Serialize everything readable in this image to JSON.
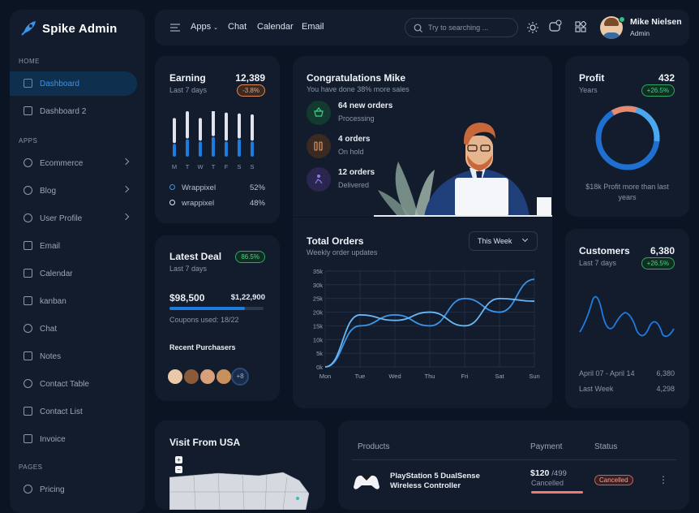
{
  "brand": {
    "name": "Spike Admin"
  },
  "sidebar": {
    "sections": [
      "HOME",
      "APPS",
      "PAGES"
    ],
    "items": [
      {
        "label": "Dashboard",
        "icon": "screen-icon"
      },
      {
        "label": "Dashboard 2",
        "icon": "chart-icon"
      },
      {
        "label": "Ecommerce",
        "icon": "cart-icon"
      },
      {
        "label": "Blog",
        "icon": "blog-icon"
      },
      {
        "label": "User Profile",
        "icon": "user-icon"
      },
      {
        "label": "Email",
        "icon": "mail-icon"
      },
      {
        "label": "Calendar",
        "icon": "calendar-icon"
      },
      {
        "label": "kanban",
        "icon": "kanban-icon"
      },
      {
        "label": "Chat",
        "icon": "chat-icon"
      },
      {
        "label": "Notes",
        "icon": "notes-icon"
      },
      {
        "label": "Contact Table",
        "icon": "phone-icon"
      },
      {
        "label": "Contact List",
        "icon": "list-icon"
      },
      {
        "label": "Invoice",
        "icon": "invoice-icon"
      },
      {
        "label": "Pricing",
        "icon": "currency-icon"
      }
    ]
  },
  "topbar": {
    "nav": [
      "Apps",
      "Chat",
      "Calendar",
      "Email"
    ],
    "search_placeholder": "Try to searching ...",
    "user_name": "Mike Nielsen",
    "user_role": "Admin"
  },
  "earning": {
    "title": "Earning",
    "value": "12,389",
    "period": "Last 7 days",
    "badge": "-3.8%",
    "days": [
      "M",
      "T",
      "W",
      "T",
      "F",
      "S",
      "S"
    ],
    "bar_gray": [
      0.55,
      0.6,
      0.5,
      0.6,
      0.62,
      0.55,
      0.58
    ],
    "bar_blue": [
      0.3,
      0.4,
      0.35,
      0.45,
      0.35,
      0.4,
      0.35
    ],
    "legend": [
      {
        "name": "Wrappixel",
        "pct": "52%"
      },
      {
        "name": "wrappixel",
        "pct": "48%"
      }
    ]
  },
  "congrats": {
    "title": "Congratulations Mike",
    "subtitle": "You have done 38% more sales",
    "items": [
      {
        "title": "64 new orders",
        "status": "Processing"
      },
      {
        "title": "4 orders",
        "status": "On hold"
      },
      {
        "title": "12 orders",
        "status": "Delivered"
      }
    ]
  },
  "profit": {
    "title": "Profit",
    "value": "432",
    "period": "Years",
    "badge": "+26.5%",
    "note": "$18k Profit more than last years"
  },
  "deal": {
    "title": "Latest Deal",
    "period": "Last 7 days",
    "badge": "86.5%",
    "amount": "$98,500",
    "target": "$1,22,900",
    "progress": 0.8,
    "coupons": "Coupons used: 18/22",
    "purchasers_title": "Recent Purchasers",
    "more": "+8"
  },
  "orders": {
    "title": "Total Orders",
    "subtitle": "Weekly order updates",
    "filter": "This Week"
  },
  "chart_data": {
    "type": "line",
    "categories": [
      "Mon",
      "Tue",
      "Wed",
      "Thu",
      "Fri",
      "Sat",
      "Sun"
    ],
    "ylim": [
      0,
      35000
    ],
    "yticks": [
      "0k",
      "5k",
      "10k",
      "15k",
      "20k",
      "25k",
      "30k",
      "35k"
    ],
    "series": [
      {
        "values": [
          0,
          15000,
          19000,
          15000,
          25000,
          20000,
          32000
        ]
      },
      {
        "values": [
          0,
          19000,
          17000,
          20000,
          15000,
          25000,
          24000
        ]
      }
    ]
  },
  "customers": {
    "title": "Customers",
    "value": "6,380",
    "period": "Last 7 days",
    "badge": "+26.5%",
    "row1_label": "April 07 - April 14",
    "row1_value": "6,380",
    "row2_label": "Last Week",
    "row2_value": "4,298"
  },
  "visit": {
    "title": "Visit From USA"
  },
  "products": {
    "headers": [
      "Products",
      "Payment",
      "Status"
    ],
    "row": {
      "name": "PlayStation 5 DualSense Wireless Controller",
      "price": "$120",
      "total": "/499",
      "payment_status": "Cancelled",
      "status": "Cancelled"
    }
  }
}
